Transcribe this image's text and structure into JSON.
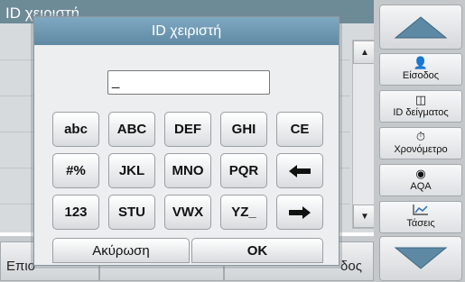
{
  "background": {
    "title": "ID χειριστή",
    "bottom_left_label": "Επιο",
    "bottom_right_label": "δος"
  },
  "dialog": {
    "title": "ID χειριστή",
    "input_value": "_",
    "keys": {
      "row1": [
        "abc",
        "ABC",
        "DEF",
        "GHI",
        "CE"
      ],
      "row2": [
        "#%",
        "JKL",
        "MNO",
        "PQR"
      ],
      "row3": [
        "123",
        "STU",
        "VWX",
        "YZ_"
      ]
    },
    "cancel_label": "Ακύρωση",
    "ok_label": "OK"
  },
  "sidebar": {
    "items": [
      {
        "label": "Είσοδος",
        "icon": "person-icon"
      },
      {
        "label": "ID δείγματος",
        "icon": "sample-vial-icon"
      },
      {
        "label": "Χρονόμετρο",
        "icon": "timer-icon"
      },
      {
        "label": "AQA",
        "icon": "aqa-icon"
      },
      {
        "label": "Τάσεις",
        "icon": "trend-chart-icon"
      }
    ]
  },
  "colors": {
    "title_bar": "#6d8a97",
    "dialog_title": "#6f99b2",
    "nav_arrow": "#5d89a4"
  }
}
